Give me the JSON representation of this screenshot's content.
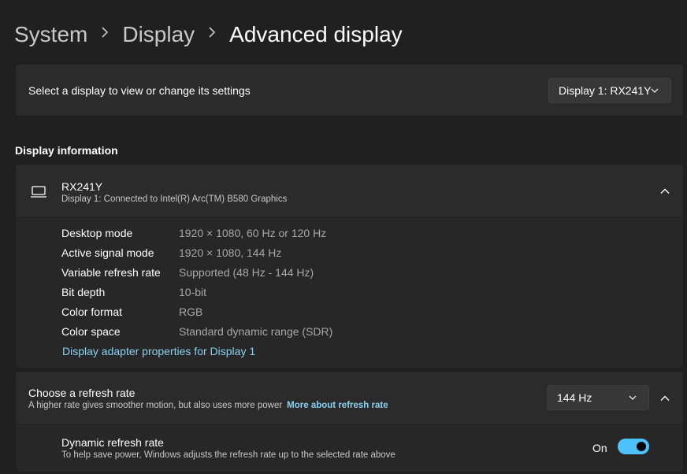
{
  "breadcrumb": {
    "items": [
      "System",
      "Display"
    ],
    "current": "Advanced display"
  },
  "select_display": {
    "label": "Select a display to view or change its settings",
    "selected": "Display 1: RX241Y"
  },
  "display_information": {
    "heading": "Display information",
    "monitor_name": "RX241Y",
    "connection": "Display 1: Connected to Intel(R) Arc(TM) B580 Graphics",
    "rows": [
      {
        "key": "Desktop mode",
        "value": "1920 × 1080, 60 Hz or 120 Hz"
      },
      {
        "key": "Active signal mode",
        "value": "1920 × 1080, 144 Hz"
      },
      {
        "key": "Variable refresh rate",
        "value": "Supported (48 Hz - 144 Hz)"
      },
      {
        "key": "Bit depth",
        "value": "10-bit"
      },
      {
        "key": "Color format",
        "value": "RGB"
      },
      {
        "key": "Color space",
        "value": "Standard dynamic range (SDR)"
      }
    ],
    "adapter_link": "Display adapter properties for Display 1"
  },
  "refresh_rate": {
    "title": "Choose a refresh rate",
    "description": "A higher rate gives smoother motion, but also uses more power",
    "more_link": "More about refresh rate",
    "selected": "144 Hz"
  },
  "dynamic_refresh": {
    "title": "Dynamic refresh rate",
    "description": "To help save power, Windows adjusts the refresh rate up to the selected rate above",
    "state_label": "On",
    "enabled": true
  },
  "icons": {
    "breadcrumb_separator": "chevron-right-icon",
    "dropdown": "chevron-down-icon",
    "collapse": "chevron-up-icon",
    "monitor": "laptop-icon"
  },
  "colors": {
    "background": "#202020",
    "card": "#2b2b2b",
    "accent": "#4cc2ff",
    "link": "#8ad0ef"
  }
}
